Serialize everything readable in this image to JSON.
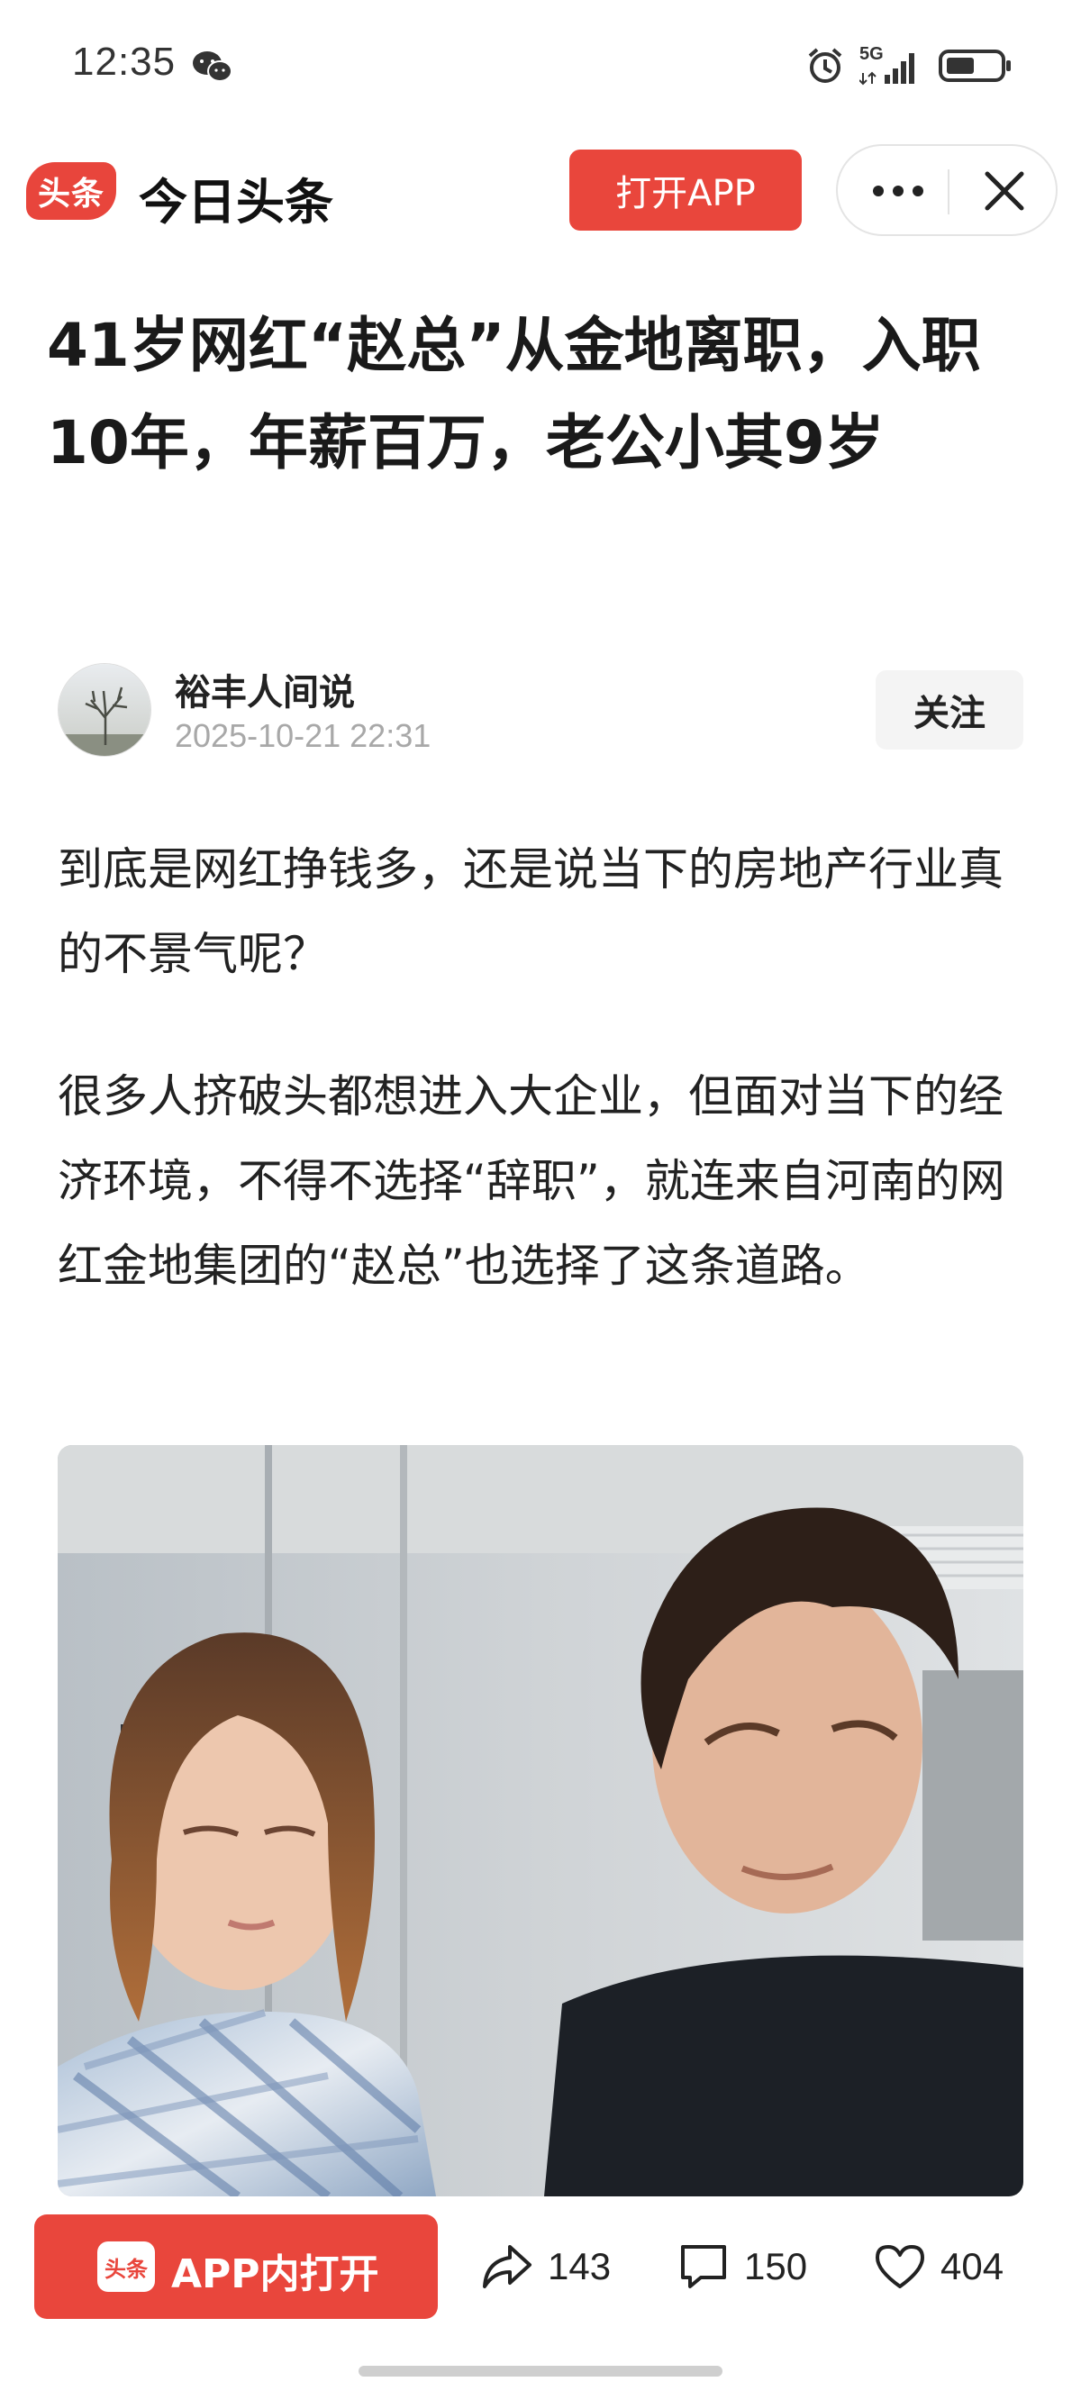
{
  "status_bar": {
    "time": "12:35",
    "network": "5G",
    "icons": [
      "wechat-icon",
      "alarm-icon",
      "signal-icon",
      "battery-icon"
    ]
  },
  "header": {
    "logo_text": "头条",
    "app_name": "今日头条",
    "open_app_label": "打开APP",
    "icons": [
      "more-icon",
      "close-icon"
    ]
  },
  "article": {
    "title": "41岁网红“赵总”从金地离职，入职10年，年薪百万，老公小其9岁",
    "author": {
      "name": "裕丰人间说",
      "time": "2025-10-21 22:31",
      "follow_label": "关注"
    },
    "paragraphs": [
      "到底是网红挣钱多，还是说当下的房地产行业真的不景气呢？",
      "很多人挤破头都想进入大企业，但面对当下的经济环境，不得不选择“辞职”，就连来自河南的网红金地集团的“赵总”也选择了这条道路。"
    ]
  },
  "bottom_bar": {
    "open_in_app_logo": "头条",
    "open_in_app_label": "APP内打开",
    "share_count": "143",
    "comment_count": "150",
    "like_count": "404",
    "icons": [
      "share-icon",
      "comment-icon",
      "like-icon"
    ]
  },
  "colors": {
    "brand_red": "#e9463c",
    "text_primary": "#222222",
    "text_muted": "#a8a8a8"
  }
}
